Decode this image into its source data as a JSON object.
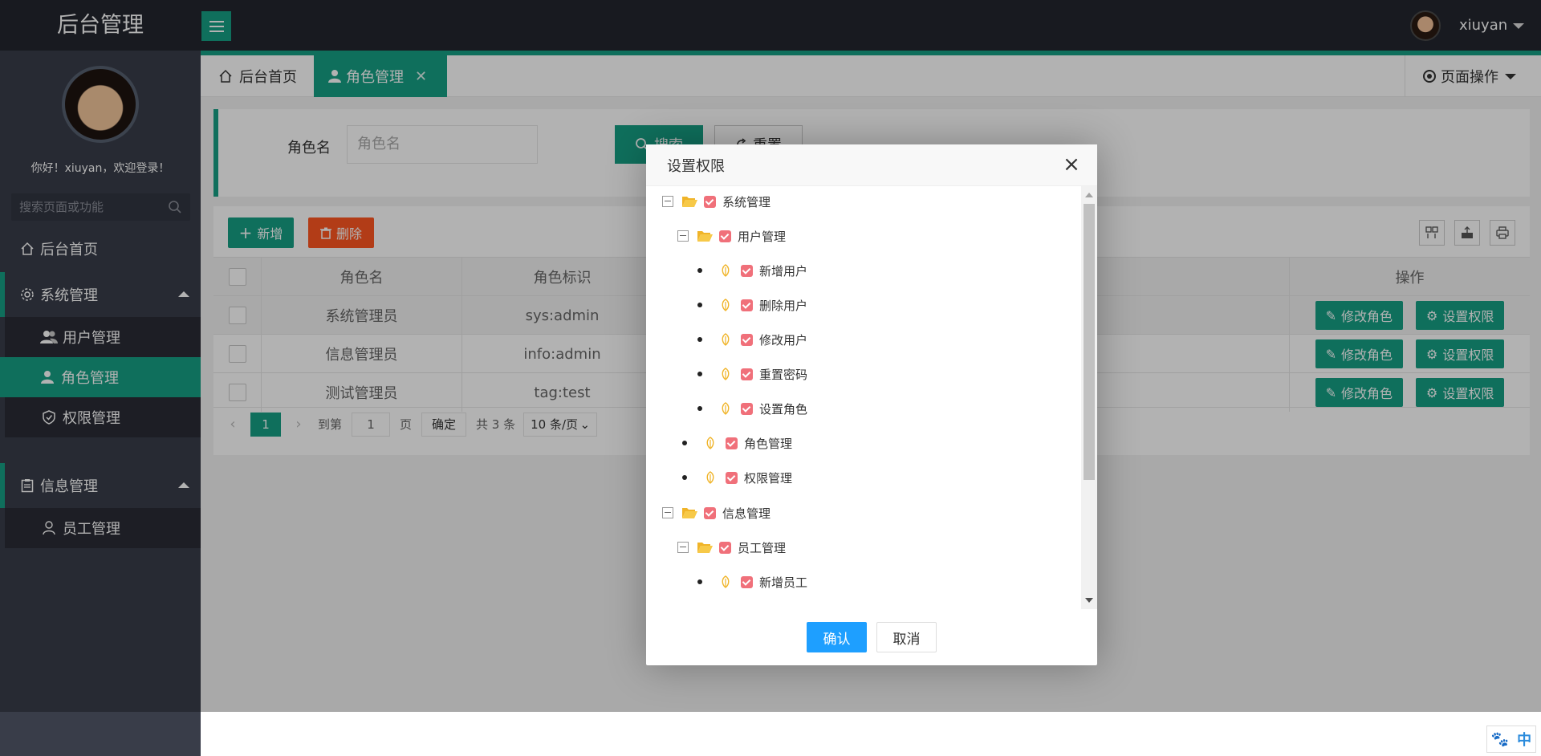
{
  "app": {
    "title": "后台管理"
  },
  "header": {
    "username": "xiuyan"
  },
  "sidebar": {
    "welcome": "你好！xiuyan，欢迎登录！",
    "search_placeholder": "搜索页面或功能",
    "home": "后台首页",
    "groups": [
      {
        "label": "系统管理",
        "items": [
          "用户管理",
          "角色管理",
          "权限管理"
        ]
      },
      {
        "label": "信息管理",
        "items": [
          "员工管理"
        ]
      }
    ]
  },
  "tabs": {
    "home": "后台首页",
    "active": "角色管理",
    "page_ops": "页面操作"
  },
  "search": {
    "label": "角色名",
    "placeholder": "角色名",
    "search_btn": "搜索",
    "reset_btn": "重置"
  },
  "toolbar": {
    "add": "新增",
    "delete": "删除"
  },
  "table": {
    "headers": {
      "name": "角色名",
      "key": "角色标识",
      "op": "操作"
    },
    "rows": [
      {
        "name": "系统管理员",
        "key": "sys:admin"
      },
      {
        "name": "信息管理员",
        "key": "info:admin"
      },
      {
        "name": "测试管理员",
        "key": "tag:test"
      }
    ],
    "op_edit": "修改角色",
    "op_perm": "设置权限"
  },
  "pager": {
    "current": "1",
    "goto_label": "到第",
    "page_input": "1",
    "page_unit": "页",
    "confirm": "确定",
    "total": "共 3 条",
    "page_size": "10 条/页"
  },
  "modal": {
    "title": "设置权限",
    "tree": [
      "系统管理",
      "用户管理",
      "新增用户",
      "删除用户",
      "修改用户",
      "重置密码",
      "设置角色",
      "角色管理",
      "权限管理",
      "信息管理",
      "员工管理",
      "新增员工"
    ],
    "ok": "确认",
    "cancel": "取消"
  },
  "ime": {
    "label": "中"
  },
  "colors": {
    "accent": "#16a085",
    "danger": "#ff5722",
    "primary": "#1e9fff",
    "checkbox": "#f0707a",
    "header": "#23262e",
    "sidebar": "#393d49"
  }
}
